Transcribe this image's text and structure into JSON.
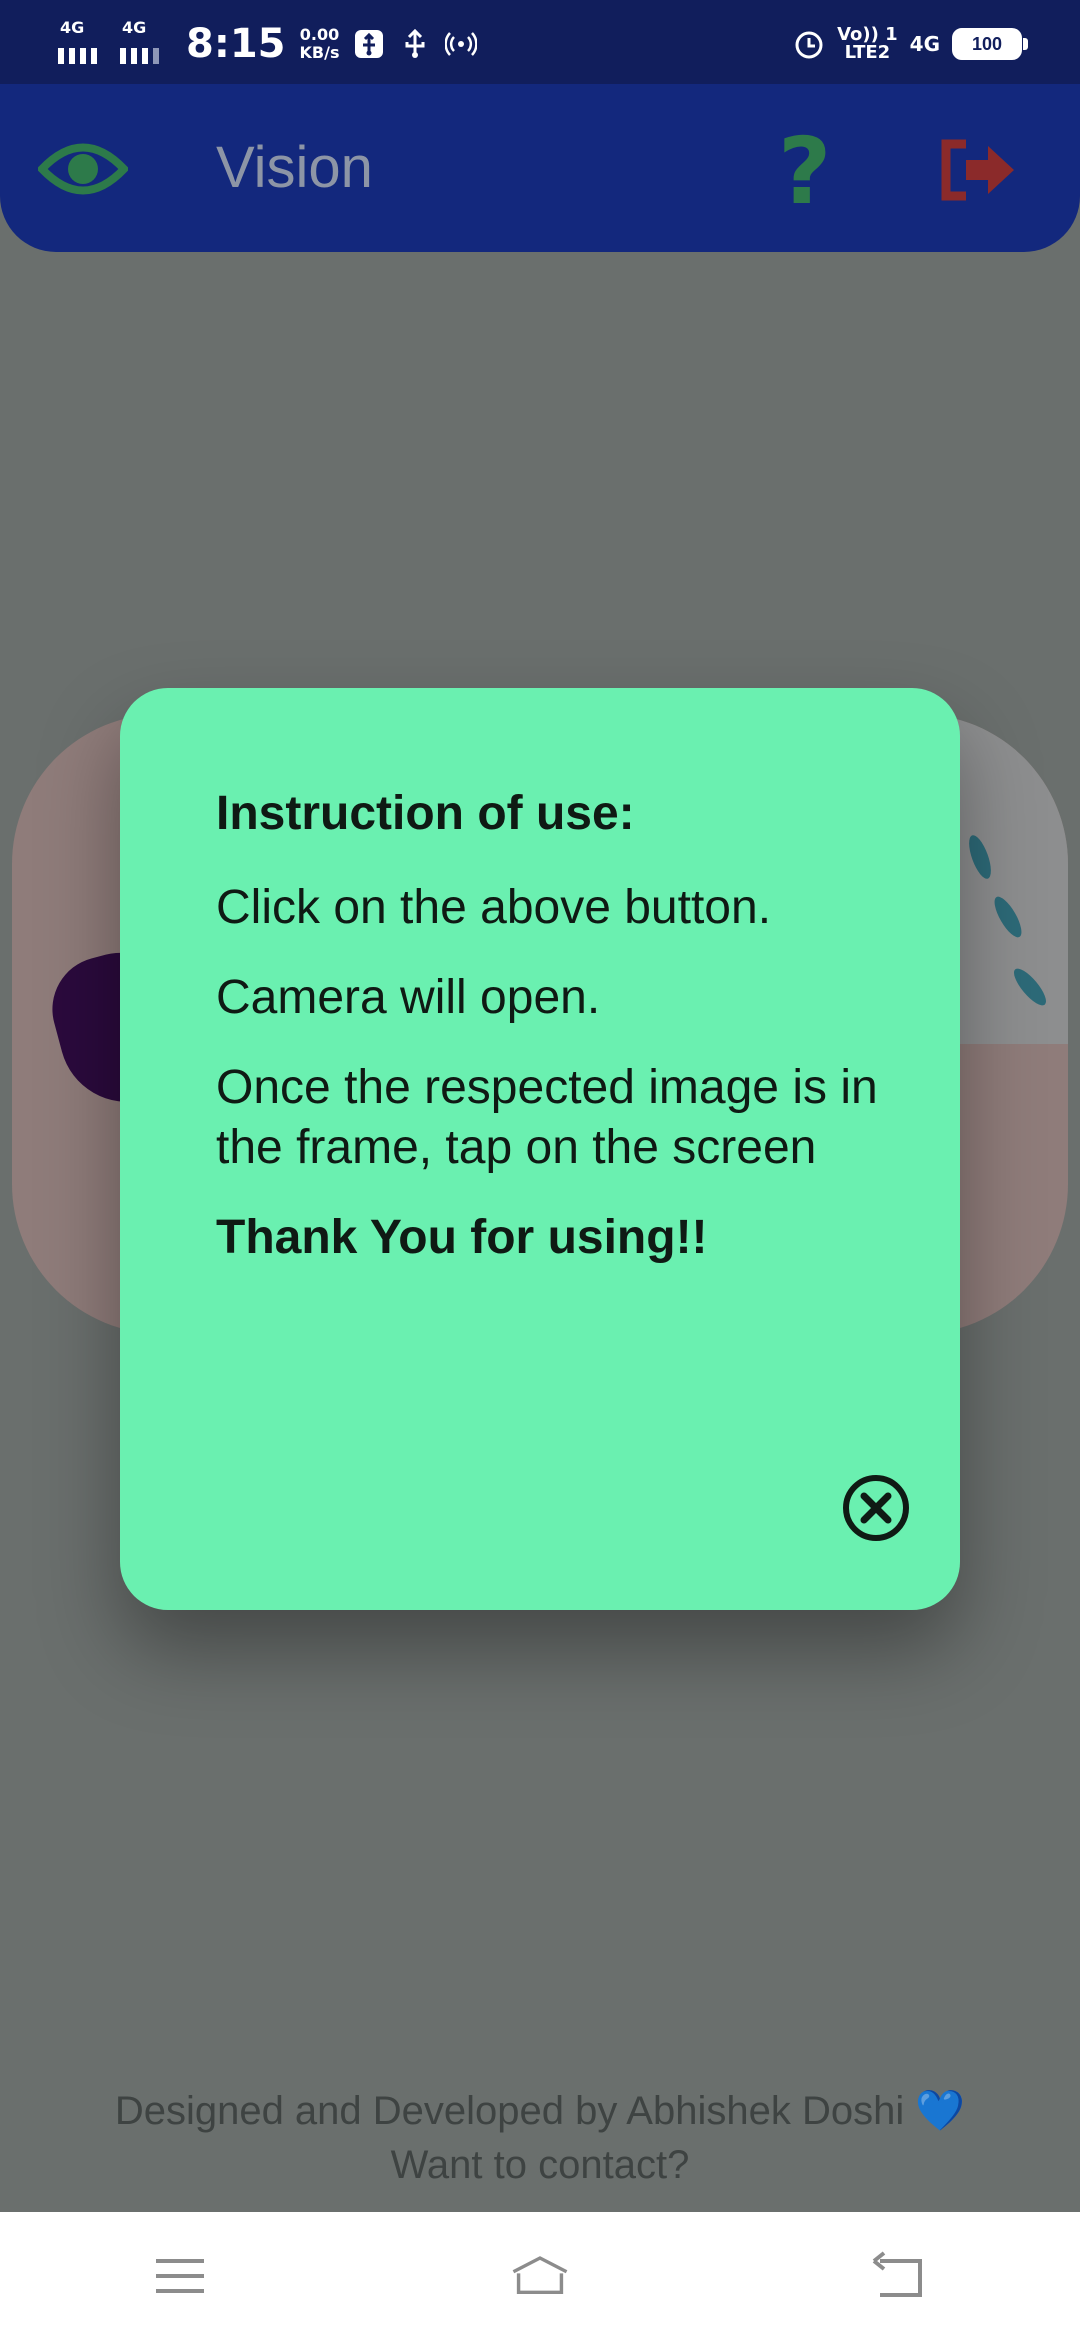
{
  "status_bar": {
    "network_1": "4G",
    "network_2": "4G",
    "time": "8:15",
    "speed_value": "0.00",
    "speed_unit": "KB/s",
    "volte_line1": "Vo)) 1",
    "volte_line2": "LTE2",
    "network_right": "4G",
    "battery": "100",
    "icons": [
      "usb-debug-icon",
      "usb-icon",
      "hotspot-icon",
      "alarm-icon"
    ]
  },
  "app_bar": {
    "title": "Vision",
    "icons": [
      "eye-icon",
      "help-icon",
      "logout-icon"
    ],
    "colors": {
      "background": "#13287d",
      "eye": "#2d7a4a",
      "help": "#2d7a4a",
      "logout": "#8b2a2a"
    }
  },
  "dialog": {
    "heading": "Instruction of use:",
    "lines": [
      "Click on the above button.",
      "Camera will open.",
      "Once the respected image is in the frame, tap on the screen"
    ],
    "closing": "Thank You for using!!",
    "close_icon": "close-circle-icon",
    "colors": {
      "background": "#6af0b0",
      "text": "#0f1a14"
    }
  },
  "footer": {
    "credit": "Designed and Developed by Abhishek Doshi",
    "heart": "💙",
    "contact": "Want to contact?"
  },
  "nav_bar": {
    "icons": [
      "menu-icon",
      "home-icon",
      "back-icon"
    ]
  }
}
